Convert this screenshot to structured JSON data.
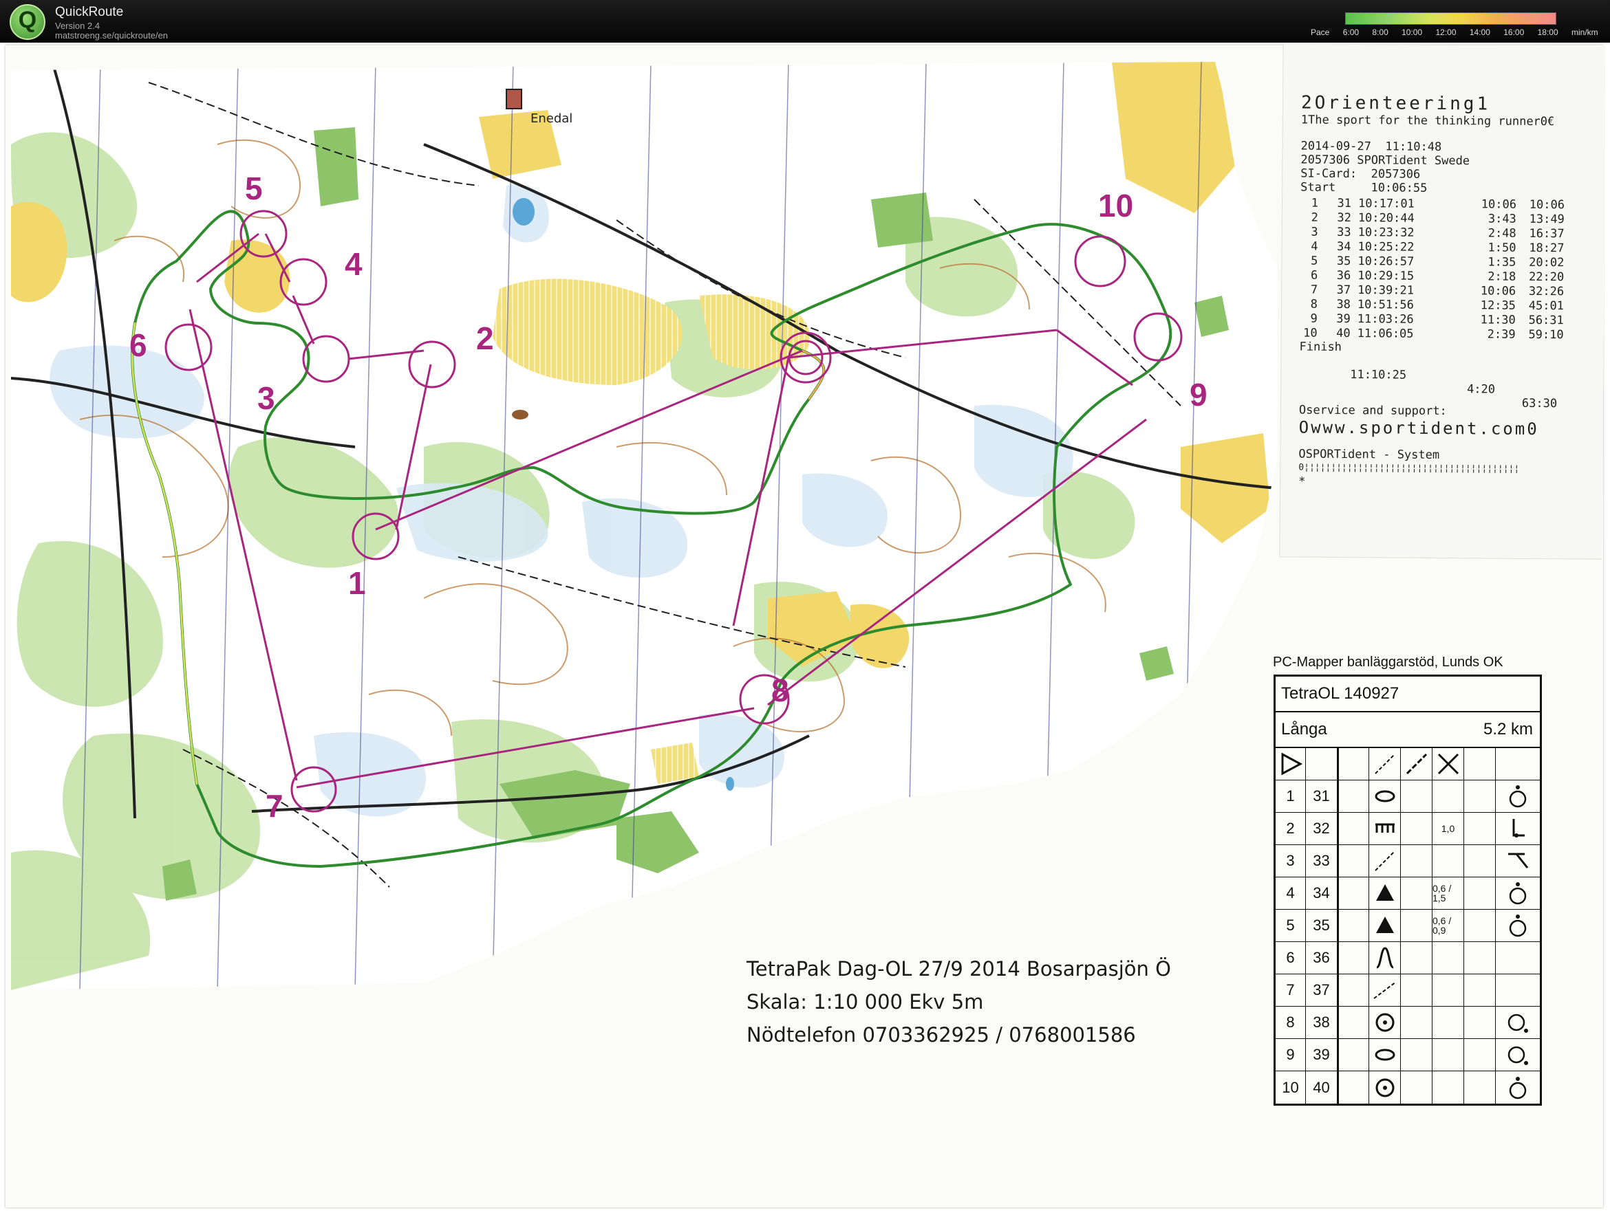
{
  "app": {
    "name": "QuickRoute",
    "version": "Version 2.4",
    "url": "matstroeng.se/quickroute/en"
  },
  "pace_scale": {
    "label": "Pace",
    "ticks": [
      "6:00",
      "8:00",
      "10:00",
      "12:00",
      "14:00",
      "16:00",
      "18:00"
    ],
    "unit": "min/km",
    "colors": [
      "#59c24a",
      "#d8e35c",
      "#f2ad52",
      "#f08a8a"
    ]
  },
  "map": {
    "place_label": "Enedal",
    "control_numbers": [
      "1",
      "2",
      "3",
      "4",
      "5",
      "6",
      "7",
      "8",
      "9",
      "10"
    ],
    "course_color": "#a8267f",
    "route_color": "#2e8b2e",
    "footer": {
      "line1": "TetraPak Dag-OL 27/9 2014 Bosarpasjön Ö",
      "line2": "Skala: 1:10 000 Ekv 5m",
      "line3": "Nödtelefon 0703362925 / 0768001586"
    }
  },
  "receipt": {
    "title": "2Orienteering1",
    "tagline": "1The sport for the thinking runner0€",
    "datetime": "2014-09-27  11:10:48",
    "station": "2057306 SPORTident Swede",
    "si_card": "SI-Card:  2057306",
    "start": "Start     10:06:55",
    "splits": [
      {
        "n": "1",
        "code": "31",
        "time": "10:17:01",
        "split": "10:06",
        "total": "10:06"
      },
      {
        "n": "2",
        "code": "32",
        "time": "10:20:44",
        "split": "3:43",
        "total": "13:49"
      },
      {
        "n": "3",
        "code": "33",
        "time": "10:23:32",
        "split": "2:48",
        "total": "16:37"
      },
      {
        "n": "4",
        "code": "34",
        "time": "10:25:22",
        "split": "1:50",
        "total": "18:27"
      },
      {
        "n": "5",
        "code": "35",
        "time": "10:26:57",
        "split": "1:35",
        "total": "20:02"
      },
      {
        "n": "6",
        "code": "36",
        "time": "10:29:15",
        "split": "2:18",
        "total": "22:20"
      },
      {
        "n": "7",
        "code": "37",
        "time": "10:39:21",
        "split": "10:06",
        "total": "32:26"
      },
      {
        "n": "8",
        "code": "38",
        "time": "10:51:56",
        "split": "12:35",
        "total": "45:01"
      },
      {
        "n": "9",
        "code": "39",
        "time": "11:03:26",
        "split": "11:30",
        "total": "56:31"
      },
      {
        "n": "10",
        "code": "40",
        "time": "11:06:05",
        "split": "2:39",
        "total": "59:10"
      }
    ],
    "finish_label": "Finish",
    "finish_time": "11:10:25",
    "finish_split": "4:20",
    "finish_total": "63:30",
    "service": "Oservice and support:",
    "website": "Owww.sportident.com0",
    "system": "OSPORTident - System",
    "barcode": "0¦¦¦¦¦¦¦¦¦¦¦¦¦¦¦¦¦¦¦¦¦¦¦¦¦¦¦¦¦¦¦¦¦¦¦¦¦¦¦¦",
    "end_mark": "*"
  },
  "control_description": {
    "maker": "PC-Mapper banläggarstöd, Lunds OK",
    "event": "TetraOL 140927",
    "course": "Långa",
    "length": "5.2 km",
    "rows": [
      {
        "n": "1",
        "code": "31",
        "symbol": "knoll-elongated",
        "dims": "",
        "appendix": "control-top"
      },
      {
        "n": "2",
        "code": "32",
        "symbol": "cliff",
        "dims": "1,0",
        "appendix": "foot-corner"
      },
      {
        "n": "3",
        "code": "33",
        "symbol": "path-crossing",
        "dims": "",
        "appendix": "corner-top"
      },
      {
        "n": "4",
        "code": "34",
        "symbol": "boulder",
        "dims": "0,6 / 1,5",
        "appendix": "control-top"
      },
      {
        "n": "5",
        "code": "35",
        "symbol": "boulder",
        "dims": "0,6 / 0,9",
        "appendix": "control-top"
      },
      {
        "n": "6",
        "code": "36",
        "symbol": "spur",
        "dims": "",
        "appendix": ""
      },
      {
        "n": "7",
        "code": "37",
        "symbol": "path-junction",
        "dims": "",
        "appendix": ""
      },
      {
        "n": "8",
        "code": "38",
        "symbol": "depression",
        "dims": "",
        "appendix": "control-side"
      },
      {
        "n": "9",
        "code": "39",
        "symbol": "knoll-elongated",
        "dims": "",
        "appendix": "control-side"
      },
      {
        "n": "10",
        "code": "40",
        "symbol": "depression",
        "dims": "",
        "appendix": "control-top"
      }
    ]
  }
}
